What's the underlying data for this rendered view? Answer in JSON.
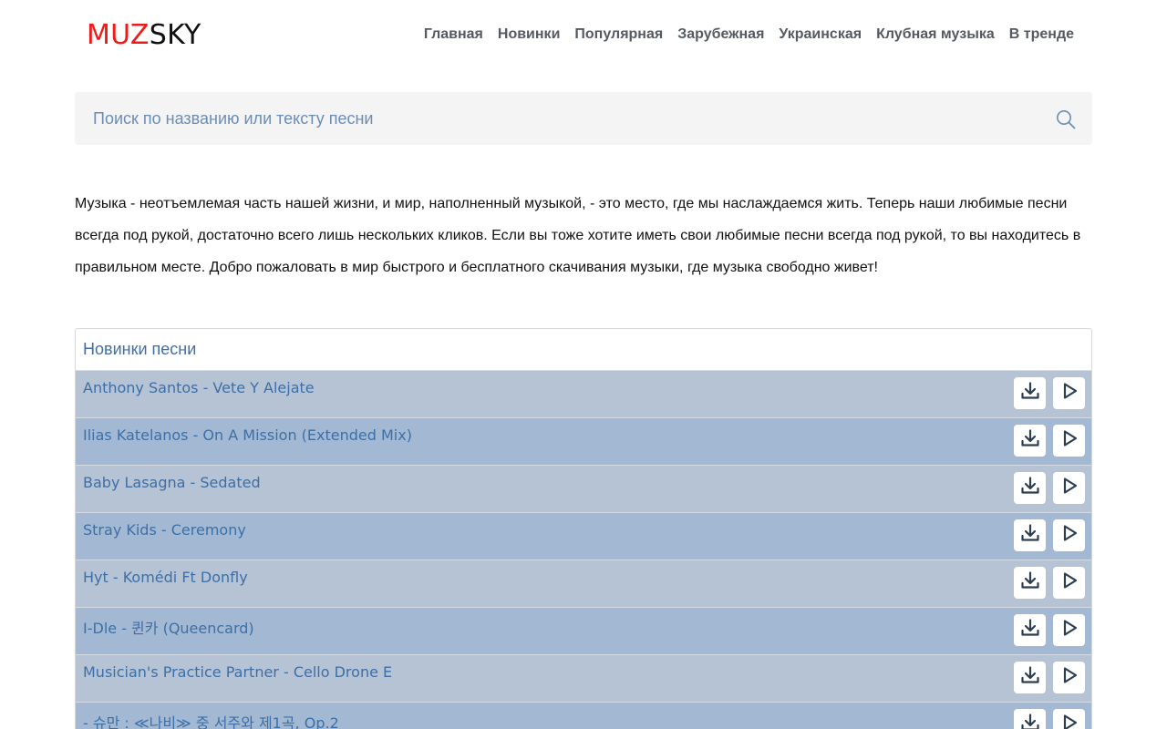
{
  "logo": {
    "part1": "MUZ",
    "part2": "SKY"
  },
  "nav": [
    "Главная",
    "Новинки",
    "Популярная",
    "Зарубежная",
    "Украинская",
    "Клубная музыка",
    "В тренде"
  ],
  "search": {
    "placeholder": "Поиск по названию или тексту песни",
    "icon": "search-icon"
  },
  "intro": "Музыка - неотъемлемая часть нашей жизни, и мир, наполненный музыкой, - это место, где мы наслаждаемся жить. Теперь наши любимые песни всегда под рукой, достаточно всего лишь нескольких кликов. Если вы тоже хотите иметь свои любимые песни всегда под рукой, то вы находитесь в правильном месте. Добро пожаловать в мир быстрого и бесплатного скачивания музыки, где музыка свободно живет!",
  "new_songs": {
    "title": "Новинки песни",
    "items": [
      "Anthony Santos - Vete Y Alejate",
      "Ilias Katelanos - On A Mission (Extended Mix)",
      "Baby Lasagna - Sedated",
      "Stray Kids - Ceremony",
      "Hyt - Komédi Ft Donfly",
      "I-Dle - 퀸카 (Queencard)",
      "Musician's Practice Partner - Cello Drone E",
      "- 슈만 : ≪나비≫ 중 서주와 제1곡, Op.2"
    ]
  },
  "colors": {
    "logo_red": "#ee1b1b",
    "row_light": "#b5c3d5",
    "row_dark": "#a3b9d3",
    "link_blue": "#3d6fa6",
    "icon_navy": "#2c3e50"
  }
}
